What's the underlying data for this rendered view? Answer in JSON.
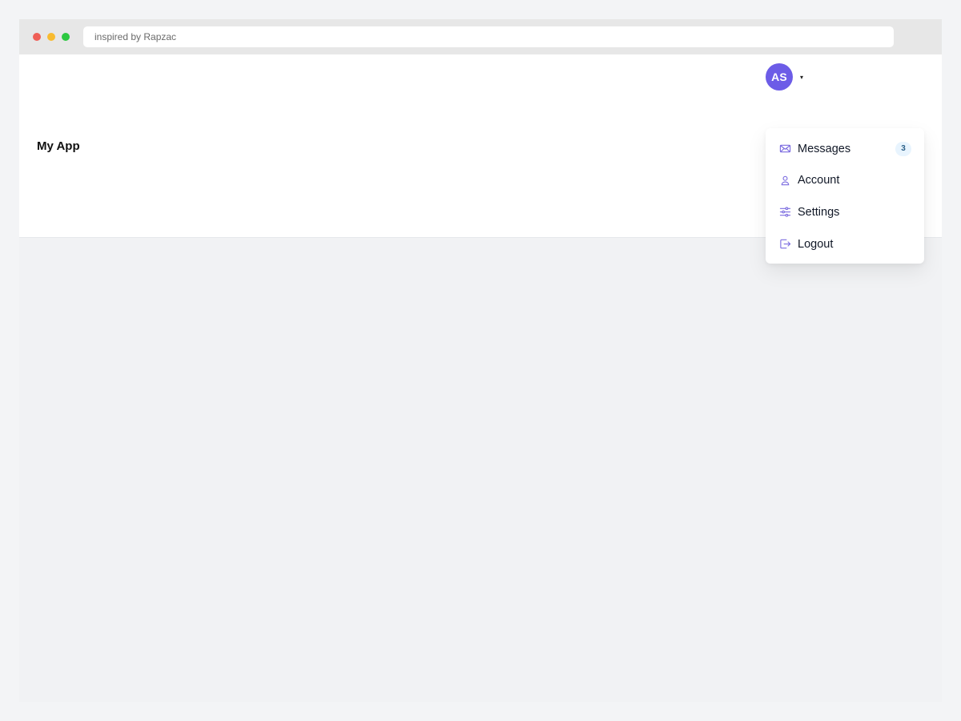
{
  "browser": {
    "address_text": "inspired by Rapzac",
    "colors": {
      "close": "#ef5f57",
      "minimize": "#f8bb30",
      "maximize": "#2cc840"
    }
  },
  "app": {
    "title": "My App"
  },
  "user": {
    "initials": "AS",
    "avatar_color": "#6c5ce7",
    "caret": "▾"
  },
  "menu": {
    "items": [
      {
        "label": "Messages",
        "icon": "mail-icon",
        "badge": "3"
      },
      {
        "label": "Account",
        "icon": "user-icon"
      },
      {
        "label": "Settings",
        "icon": "sliders-icon"
      },
      {
        "label": "Logout",
        "icon": "logout-icon"
      }
    ],
    "icon_color": "#7c6ce0"
  }
}
